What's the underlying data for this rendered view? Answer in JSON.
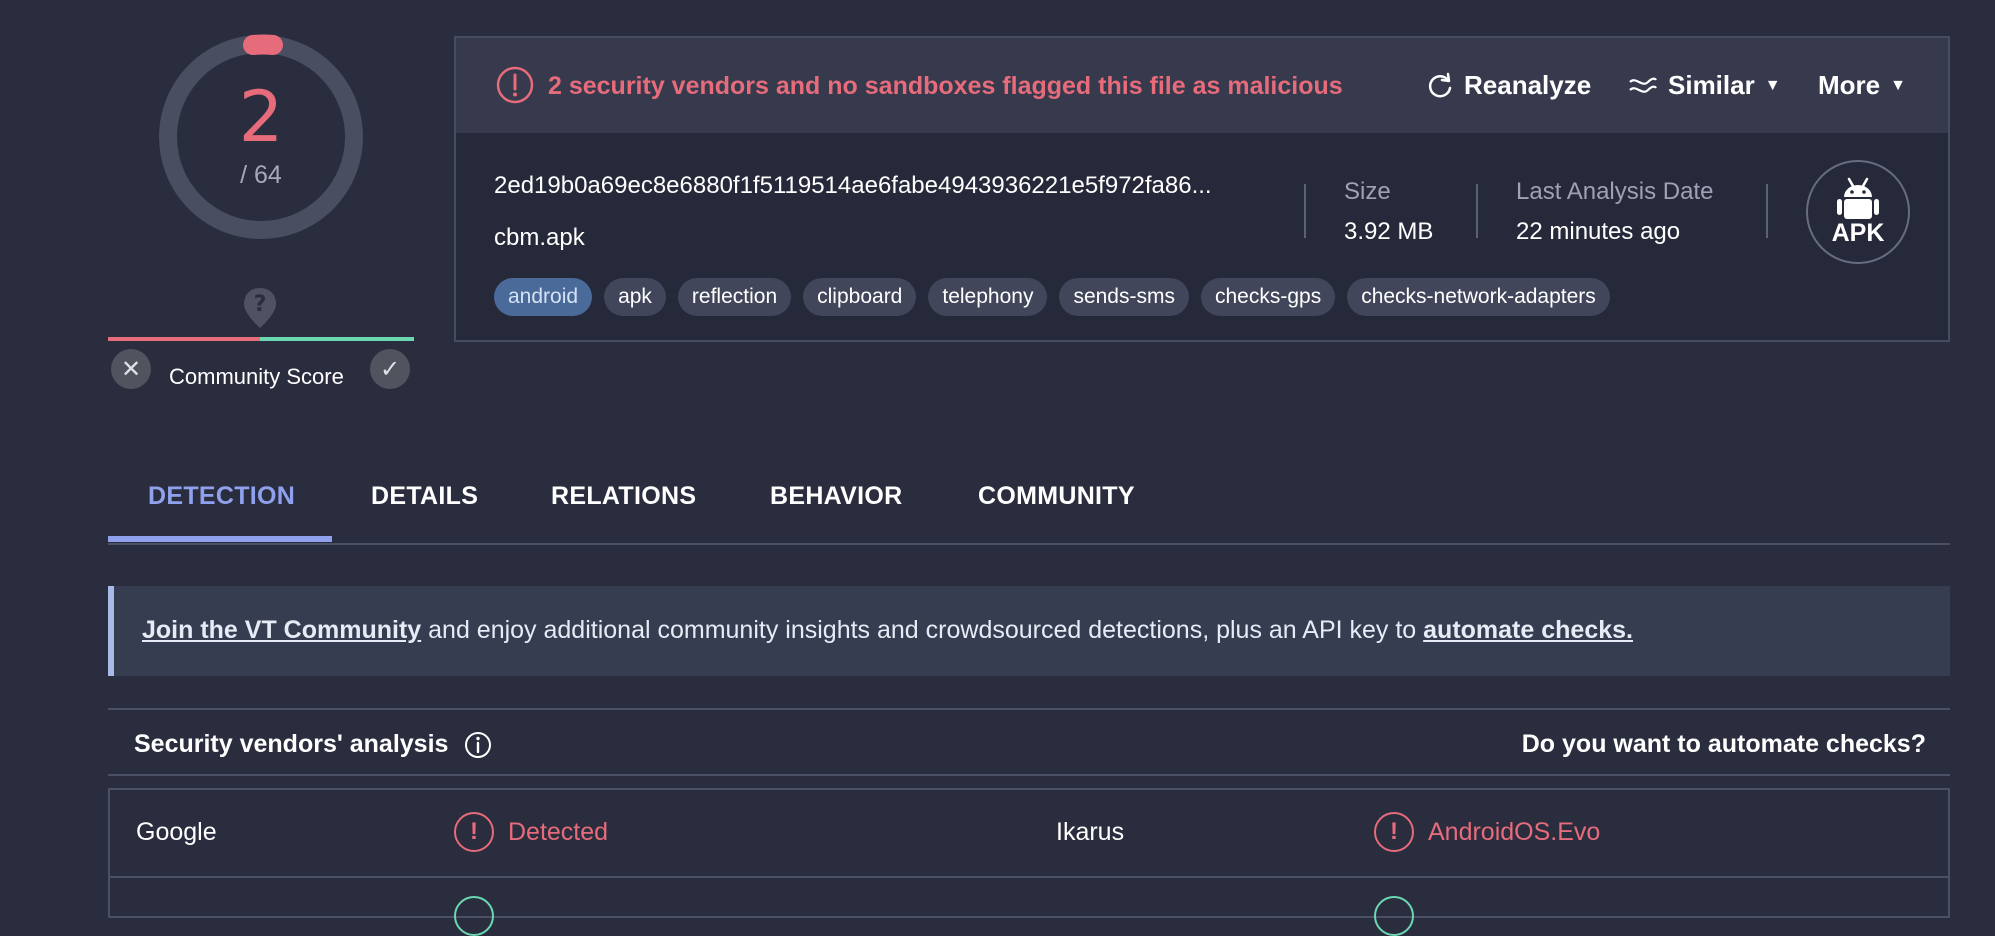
{
  "score": {
    "detections": "2",
    "total": "/ 64"
  },
  "community": {
    "label": "Community Score",
    "question_mark": "?"
  },
  "header": {
    "warning": "2 security vendors and no sandboxes flagged this file as malicious",
    "reanalyze": "Reanalyze",
    "similar": "Similar",
    "more": "More"
  },
  "file": {
    "hash": "2ed19b0a69ec8e6880f1f5119514ae6fabe4943936221e5f972fa86...",
    "name": "cbm.apk",
    "size_label": "Size",
    "size_value": "3.92 MB",
    "date_label": "Last Analysis Date",
    "date_value": "22 minutes ago",
    "type_badge": "APK",
    "tags": [
      "android",
      "apk",
      "reflection",
      "clipboard",
      "telephony",
      "sends-sms",
      "checks-gps",
      "checks-network-adapters"
    ]
  },
  "tabs": [
    "DETECTION",
    "DETAILS",
    "RELATIONS",
    "BEHAVIOR",
    "COMMUNITY"
  ],
  "banner": {
    "link1": "Join the VT Community",
    "text": " and enjoy additional community insights and crowdsourced detections, plus an API key to ",
    "link2": "automate checks."
  },
  "analysis": {
    "title": "Security vendors' analysis",
    "automate": "Do you want to automate checks?",
    "rows": [
      {
        "vendor1": "Google",
        "result1": "Detected",
        "vendor2": "Ikarus",
        "result2": "AndroidOS.Evo"
      }
    ]
  },
  "colors": {
    "malicious": "#e66b7b",
    "accent": "#8fa1ec",
    "harmless": "#6cd8b1"
  }
}
